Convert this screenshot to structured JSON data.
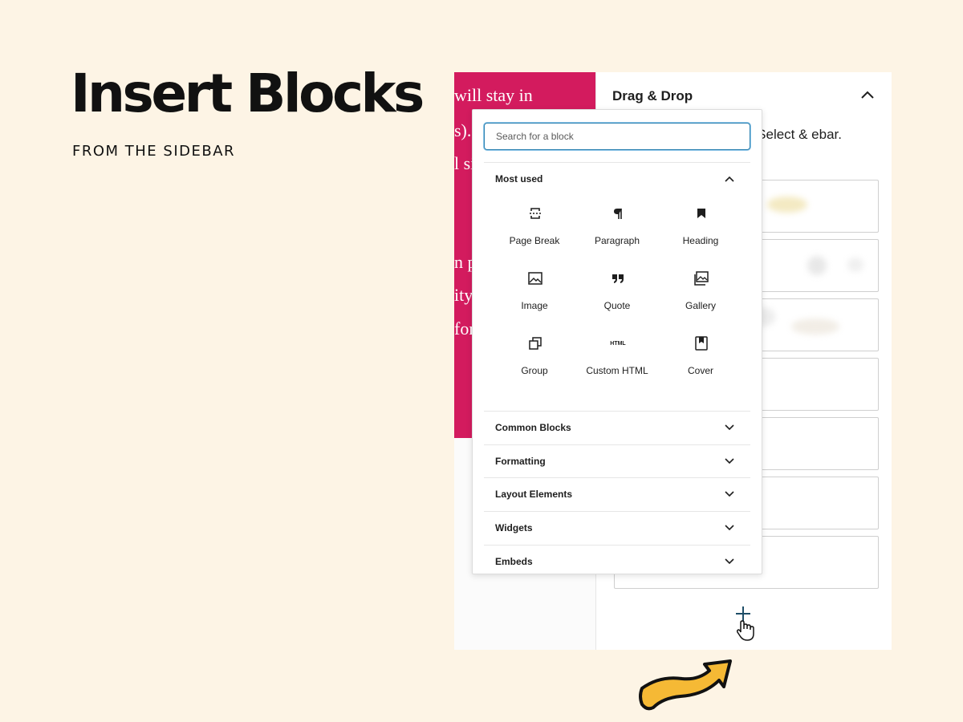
{
  "slide": {
    "title": "Insert Blocks",
    "subtitle": "FROM THE SIDEBAR"
  },
  "editor": {
    "text_fragments": [
      "will stay in",
      "s).",
      "l si",
      "n p",
      "ity",
      "for"
    ],
    "background": "#d31b5e"
  },
  "sidebar": {
    "title": "Drag & Drop",
    "description": "lete, Select & ebar."
  },
  "inserter": {
    "search_placeholder": "Search for a block",
    "most_used": {
      "label": "Most used",
      "expanded": true,
      "blocks": [
        {
          "label": "Page Break",
          "icon": "page-break-icon"
        },
        {
          "label": "Paragraph",
          "icon": "paragraph-icon"
        },
        {
          "label": "Heading",
          "icon": "heading-bookmark-icon"
        },
        {
          "label": "Image",
          "icon": "image-icon"
        },
        {
          "label": "Quote",
          "icon": "quote-icon"
        },
        {
          "label": "Gallery",
          "icon": "gallery-icon"
        },
        {
          "label": "Group",
          "icon": "group-icon"
        },
        {
          "label": "Custom HTML",
          "icon": "html-icon",
          "icon_text": "HTML"
        },
        {
          "label": "Cover",
          "icon": "cover-icon"
        }
      ]
    },
    "categories": [
      {
        "label": "Common Blocks",
        "expanded": false
      },
      {
        "label": "Formatting",
        "expanded": false
      },
      {
        "label": "Layout Elements",
        "expanded": false
      },
      {
        "label": "Widgets",
        "expanded": false
      },
      {
        "label": "Embeds",
        "expanded": false
      }
    ]
  },
  "colors": {
    "accent": "#2a80b0",
    "arrow_fill": "#f5b935",
    "background": "#fdf4e5"
  }
}
